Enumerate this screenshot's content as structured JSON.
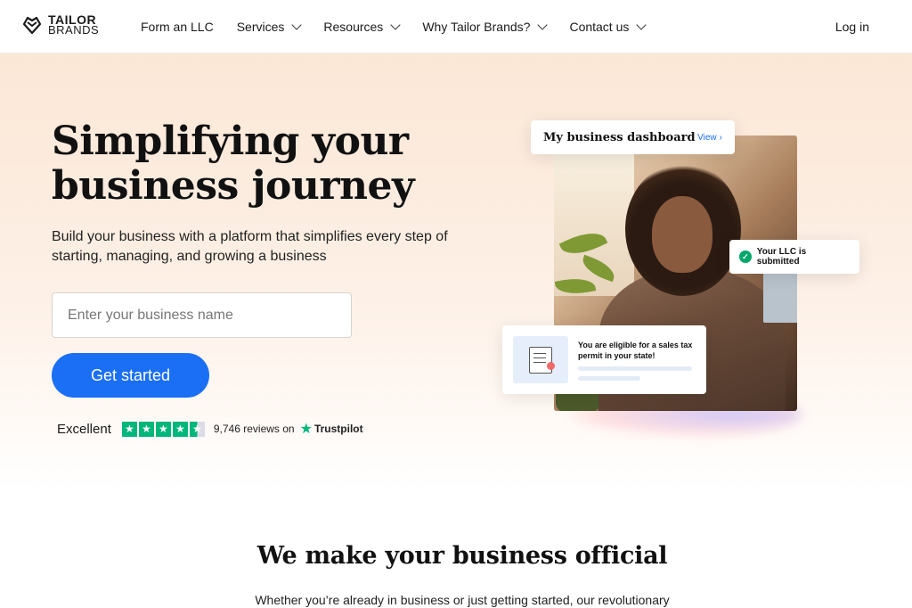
{
  "nav": {
    "logo_line1": "TAILOR",
    "logo_line2": "BRANDS",
    "items": [
      {
        "label": "Form an LLC",
        "has_dropdown": false
      },
      {
        "label": "Services",
        "has_dropdown": true
      },
      {
        "label": "Resources",
        "has_dropdown": true
      },
      {
        "label": "Why Tailor Brands?",
        "has_dropdown": true
      },
      {
        "label": "Contact us",
        "has_dropdown": true
      }
    ],
    "login": "Log in"
  },
  "hero": {
    "headline_line1": "Simplifying your",
    "headline_line2": "business journey",
    "subtext": "Build your business with a platform that simplifies every step of starting, managing, and growing a business",
    "input_placeholder": "Enter your business name",
    "cta": "Get started"
  },
  "trust": {
    "rating_word": "Excellent",
    "stars": 4.5,
    "reviews": "9,746 reviews on",
    "provider": "Trustpilot"
  },
  "cards": {
    "dashboard_title": "My business dashboard",
    "dashboard_link": "View",
    "llc_status": "Your LLC is submitted",
    "tax_notice": "You are eligible for a sales tax permit in your state!"
  },
  "section2": {
    "title": "We make your business official",
    "text": "Whether you’re already in business or just getting started, our revolutionary"
  },
  "colors": {
    "accent": "#1a6ff5",
    "trustpilot": "#00b67a",
    "hero_bg": "#fbe7d6"
  }
}
